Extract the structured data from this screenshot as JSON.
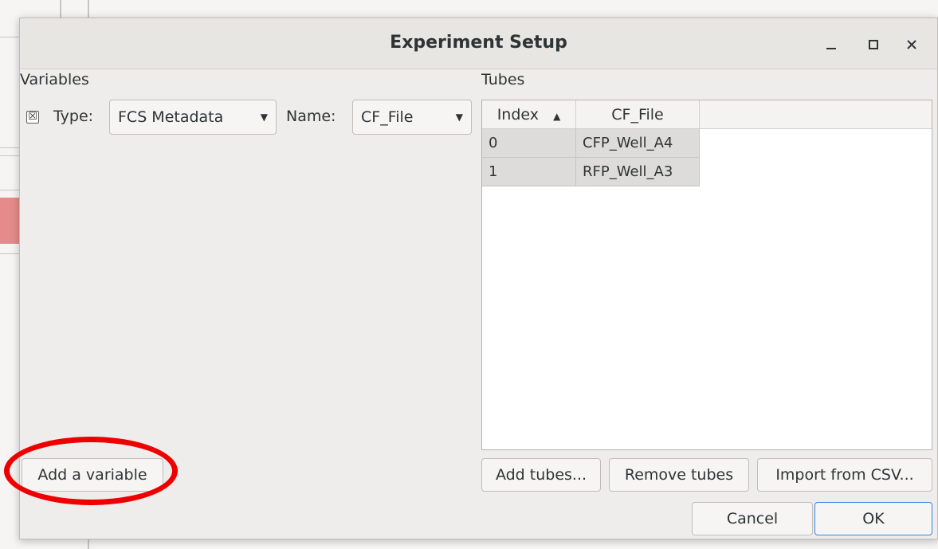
{
  "window": {
    "title": "Experiment Setup",
    "minimize_icon": "minimize-icon",
    "maximize_icon": "maximize-icon",
    "close_icon": "close-icon"
  },
  "variables": {
    "section_label": "Variables",
    "row": {
      "remove_glyph": "☒",
      "type_label": "Type:",
      "type_value": "FCS Metadata",
      "name_label": "Name:",
      "name_value": "CF_File"
    },
    "add_button": "Add a variable"
  },
  "tubes": {
    "section_label": "Tubes",
    "columns": [
      "Index",
      "CF_File"
    ],
    "sort_glyph": "▲",
    "rows": [
      [
        "0",
        "CFP_Well_A4"
      ],
      [
        "1",
        "RFP_Well_A3"
      ]
    ],
    "add_button": "Add tubes...",
    "remove_button": "Remove tubes",
    "import_button": "Import from CSV..."
  },
  "footer": {
    "cancel": "Cancel",
    "ok": "OK"
  },
  "annotation": {
    "highlight_color": "#ee0000"
  }
}
